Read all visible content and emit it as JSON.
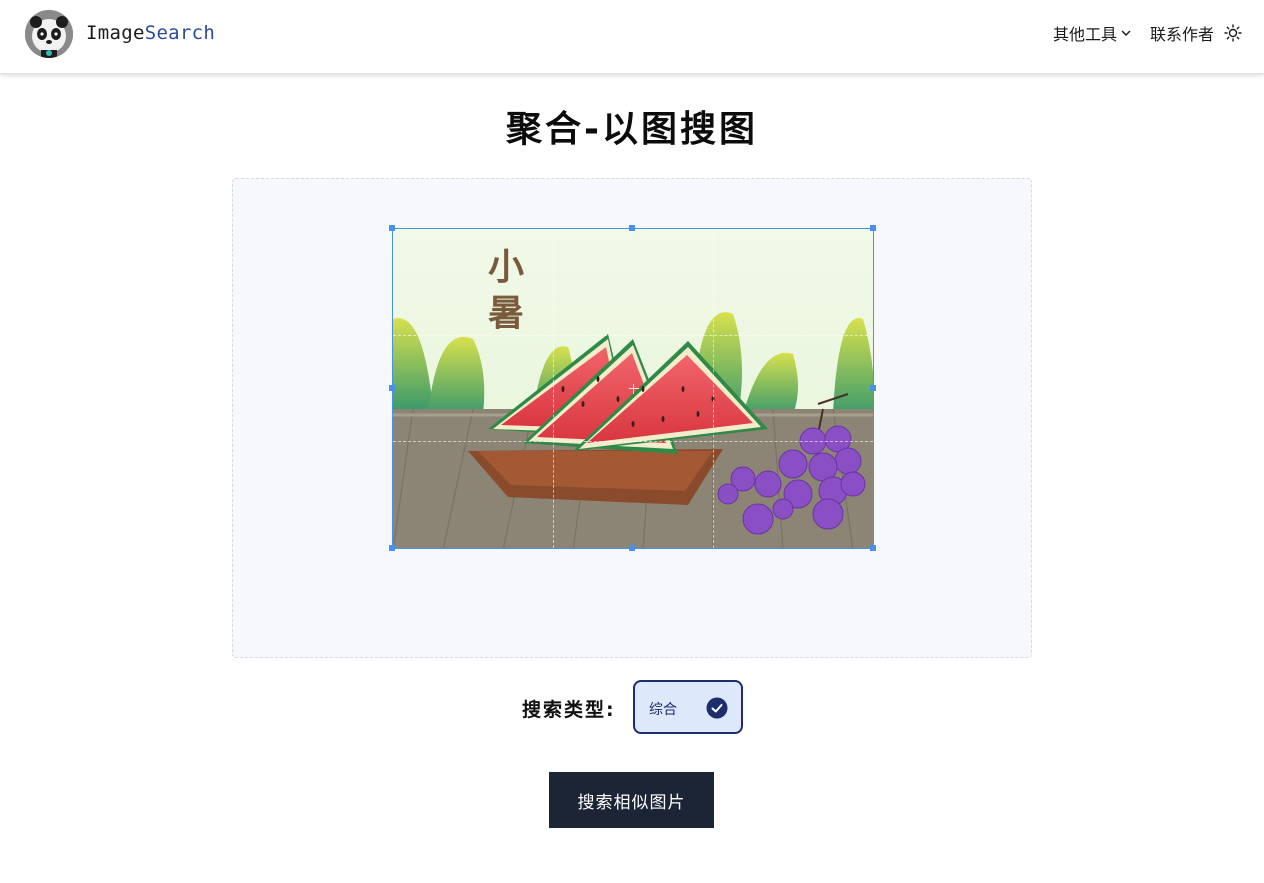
{
  "header": {
    "brand_part1": "Image",
    "brand_part2": "Search",
    "logo_icon": "panda-avatar-icon",
    "nav": [
      {
        "label": "其他工具",
        "icon": "chevron-down-icon"
      },
      {
        "label": "联系作者"
      }
    ],
    "theme_icon": "sun-icon"
  },
  "main": {
    "title": "聚合-以图搜图",
    "uploaded_image": {
      "caption_text": "小暑",
      "icon": "watermelon-grapes-illustration"
    },
    "search_type": {
      "label": "搜索类型:",
      "options": [
        {
          "label": "综合",
          "selected": true
        }
      ]
    },
    "submit_label": "搜索相似图片"
  },
  "colors": {
    "brand_accent": "#2c4a9e",
    "crop_border": "#4a90e8",
    "option_border": "#1e2d6b",
    "option_bg": "#dde8fb",
    "button_bg": "#1c2536"
  }
}
